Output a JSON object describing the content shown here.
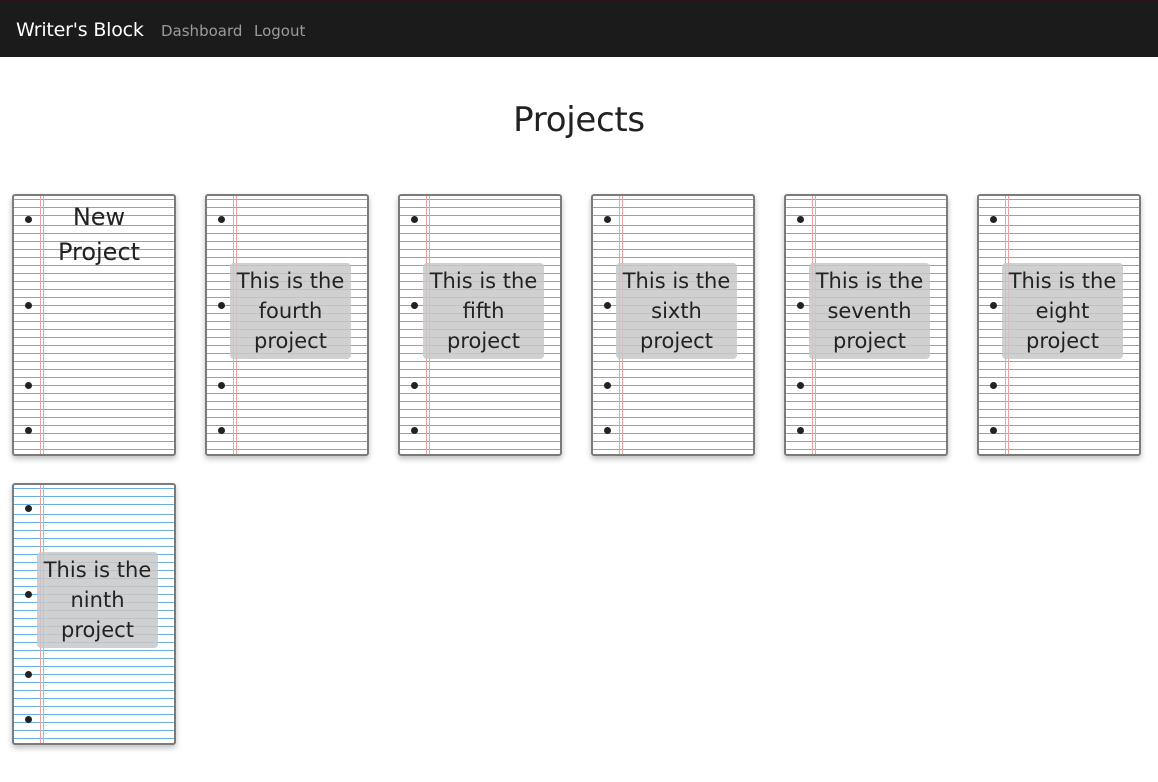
{
  "navbar": {
    "brand": "Writer's Block",
    "links": [
      "Dashboard",
      "Logout"
    ]
  },
  "page": {
    "title": "Projects"
  },
  "new_project": {
    "label": "New Project"
  },
  "projects": [
    {
      "label": "This is the fourth project"
    },
    {
      "label": "This is the fifth project"
    },
    {
      "label": "This is the sixth project"
    },
    {
      "label": "This is the seventh project"
    },
    {
      "label": "This is the eight project"
    },
    {
      "label": "This is the ninth project"
    }
  ],
  "colors": {
    "navbar_bg": "#1b1b1b",
    "ruled_line": "#6aaee6",
    "margin_line": "#e9a3a3",
    "label_bg": "#c8c8c8"
  }
}
